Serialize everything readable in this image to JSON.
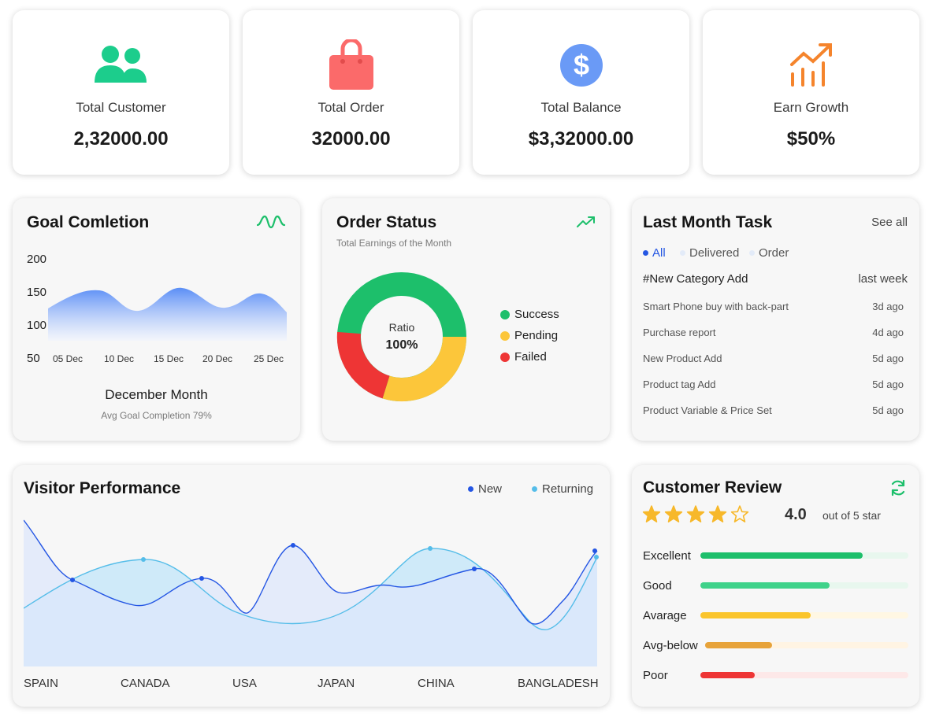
{
  "stats": [
    {
      "label": "Total Customer",
      "value": "2,32000.00",
      "icon": "users-icon",
      "color": "#1ccd8c"
    },
    {
      "label": "Total Order",
      "value": "32000.00",
      "icon": "shopping-bag-icon",
      "color": "#fb6a6a"
    },
    {
      "label": "Total Balance",
      "value": "$3,32000.00",
      "icon": "dollar-icon",
      "color": "#6a9af6"
    },
    {
      "label": "Earn Growth",
      "value": "$50%",
      "icon": "growth-chart-icon",
      "color": "#f5842c"
    }
  ],
  "goal": {
    "title": "Goal Comletion",
    "y_ticks": [
      "200",
      "150",
      "100",
      "50"
    ],
    "x_ticks": [
      "05 Dec",
      "10 Dec",
      "15 Dec",
      "20 Dec",
      "25 Dec"
    ],
    "month": "December Month",
    "avg_text": "Avg Goal Completion 79%"
  },
  "order_status": {
    "title": "Order Status",
    "subtitle": "Total Earnings of  the Month",
    "center_label": "Ratio",
    "center_value": "100%",
    "legend": [
      {
        "label": "Success",
        "color": "#1dbf6b"
      },
      {
        "label": "Pending",
        "color": "#fcc63a"
      },
      {
        "label": "Failed",
        "color": "#ee3535"
      }
    ]
  },
  "tasks": {
    "title": "Last Month Task",
    "see_all": "See all",
    "filters": [
      "All",
      "Delivered",
      "Order"
    ],
    "header": {
      "text": "#New Category Add",
      "time": "last week"
    },
    "items": [
      {
        "text": "Smart Phone buy with back-part",
        "time": "3d ago"
      },
      {
        "text": "Purchase report",
        "time": "4d ago"
      },
      {
        "text": "New Product Add",
        "time": "5d ago"
      },
      {
        "text": "Product tag Add",
        "time": "5d ago"
      },
      {
        "text": "Product Variable & Price Set",
        "time": "5d ago"
      }
    ]
  },
  "visitor": {
    "title": "Visitor Performance",
    "legend_new": "New",
    "legend_returning": "Returning",
    "countries": [
      "SPAIN",
      "CANADA",
      "USA",
      "JAPAN",
      "CHINA",
      "BANGLADESH"
    ]
  },
  "review": {
    "title": "Customer Review",
    "rating": "4.0",
    "rating_suffix": "out of 5 star",
    "stars_filled": 4,
    "stars_total": 5,
    "rows": [
      {
        "label": "Excellent",
        "fill": 0.78,
        "color": "#1dbf6b",
        "track": "#e8f7ee"
      },
      {
        "label": "Good",
        "fill": 0.62,
        "color": "#3fd28a",
        "track": "#e8f7ee"
      },
      {
        "label": "Avarage",
        "fill": 0.53,
        "color": "#fac52c",
        "track": "#fff7e3"
      },
      {
        "label": "Avg-below",
        "fill": 0.33,
        "color": "#e7a33a",
        "track": "#fff4e3"
      },
      {
        "label": "Poor",
        "fill": 0.26,
        "color": "#ee3535",
        "track": "#fde8e8"
      }
    ]
  }
}
